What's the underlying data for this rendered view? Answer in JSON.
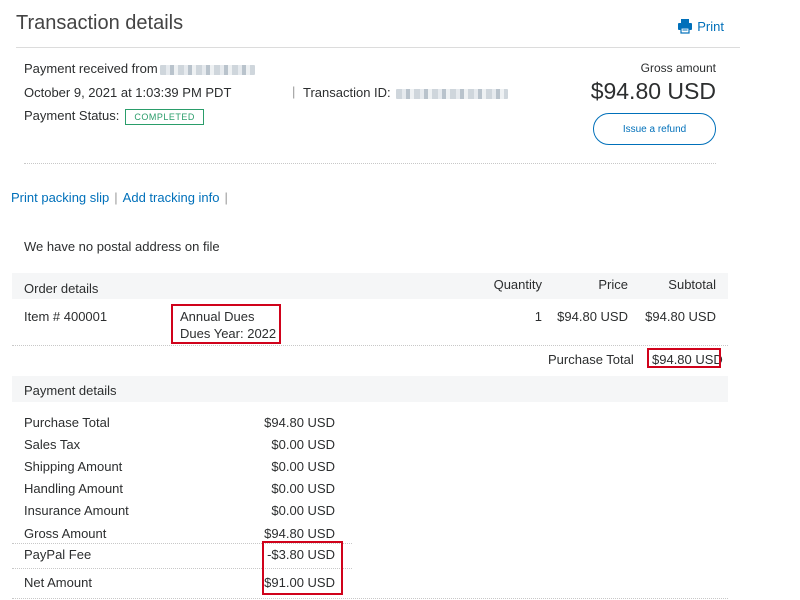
{
  "header": {
    "title": "Transaction details",
    "print_label": "Print"
  },
  "summary": {
    "payment_received_label": "Payment received from",
    "date": "October 9, 2021 at 1:03:39 PM PDT",
    "transaction_id_label": "Transaction ID:",
    "payment_status_label": "Payment Status:",
    "status": "COMPLETED",
    "gross_label": "Gross amount",
    "gross_amount": "$94.80 USD",
    "refund_label": "Issue a refund"
  },
  "actions": {
    "print_slip": "Print packing slip",
    "add_tracking": "Add tracking info"
  },
  "address_note": "We have no postal address on file",
  "order": {
    "section_label": "Order details",
    "columns": {
      "quantity": "Quantity",
      "price": "Price",
      "subtotal": "Subtotal"
    },
    "item": {
      "item_number": "Item # 400001",
      "name": "Annual Dues",
      "year": "Dues Year: 2022",
      "quantity": "1",
      "price": "$94.80 USD",
      "subtotal": "$94.80 USD"
    },
    "purchase_total_label": "Purchase Total",
    "purchase_total": "$94.80 USD"
  },
  "payment": {
    "section_label": "Payment details",
    "rows": [
      {
        "label": "Purchase Total",
        "value": "$94.80 USD"
      },
      {
        "label": "Sales Tax",
        "value": "$0.00 USD"
      },
      {
        "label": "Shipping Amount",
        "value": "$0.00 USD"
      },
      {
        "label": "Handling Amount",
        "value": "$0.00 USD"
      },
      {
        "label": "Insurance Amount",
        "value": "$0.00 USD"
      },
      {
        "label": "Gross Amount",
        "value": "$94.80 USD"
      },
      {
        "label": "PayPal Fee",
        "value": "-$3.80 USD"
      },
      {
        "label": "Net Amount",
        "value": "$91.00 USD"
      }
    ]
  },
  "colors": {
    "link": "#0070ba",
    "status": "#2a9d6a",
    "highlight": "#d0021b"
  }
}
